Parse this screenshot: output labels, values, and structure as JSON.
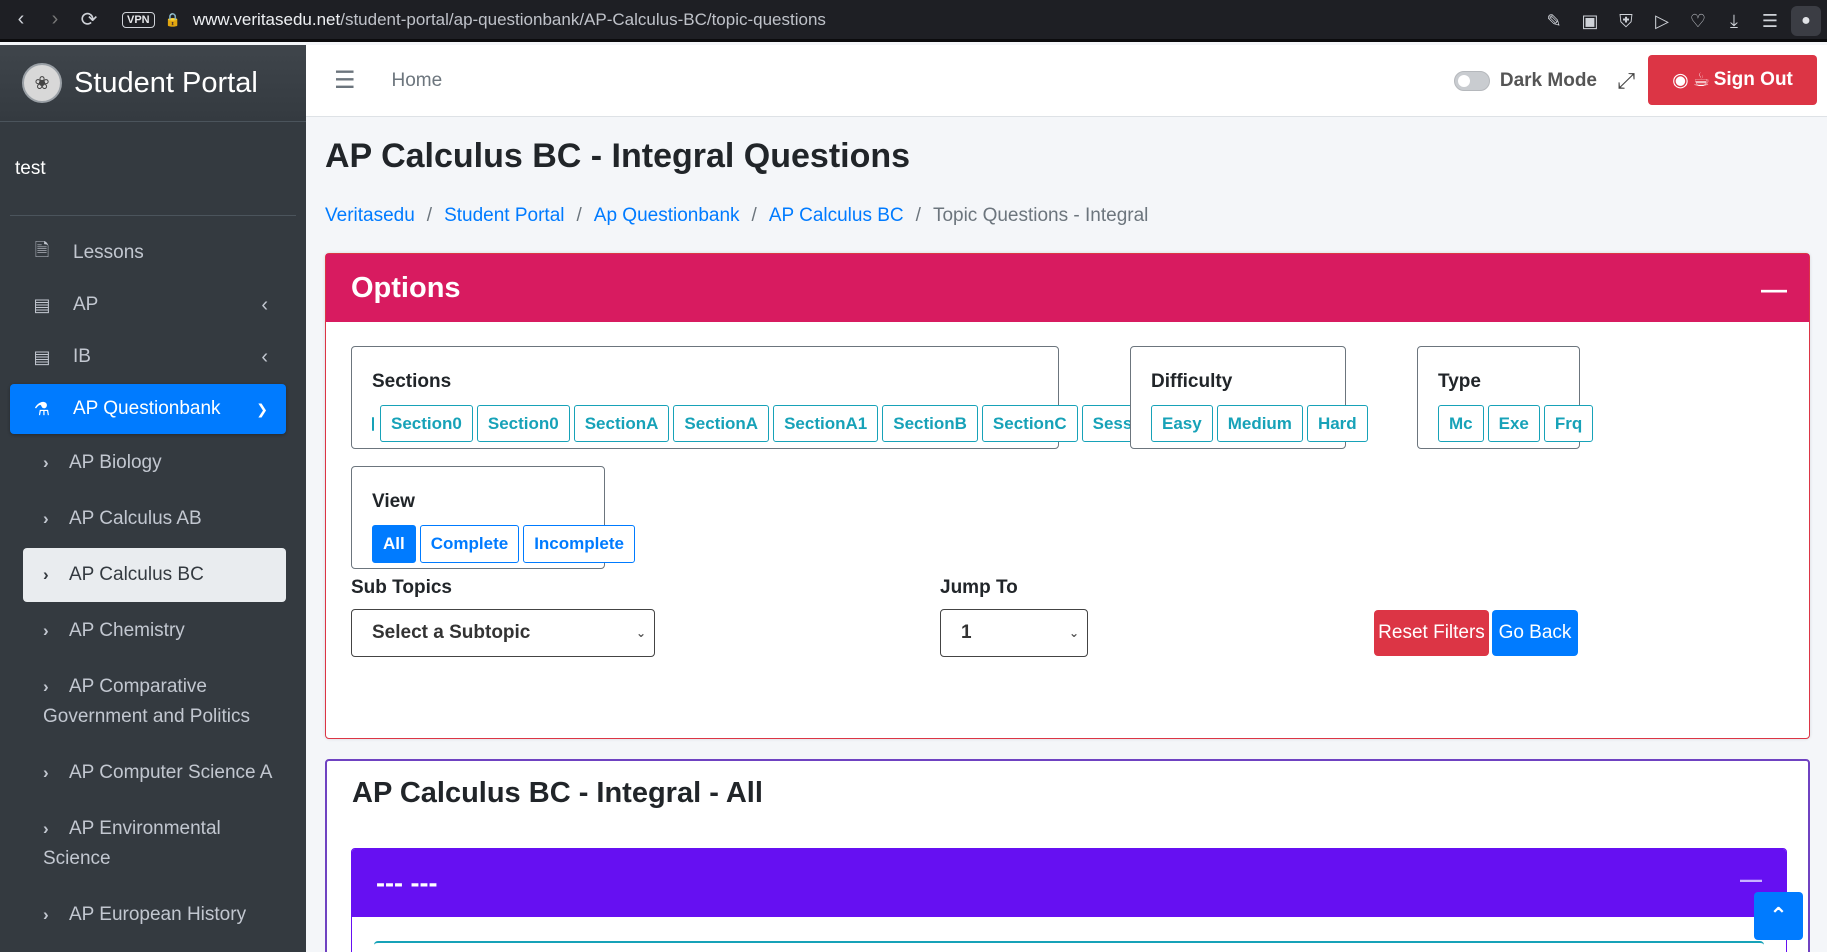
{
  "browser": {
    "url_domain": "www.veritasedu.net",
    "url_path": "/student-portal/ap-questionbank/AP-Calculus-BC/topic-questions",
    "vpn_label": "VPN"
  },
  "sidebar": {
    "brand": "Student Portal",
    "user": "test",
    "items": [
      {
        "label": "Lessons"
      },
      {
        "label": "AP"
      },
      {
        "label": "IB"
      },
      {
        "label": "AP Questionbank"
      }
    ],
    "sub_items": [
      {
        "label": "AP Biology"
      },
      {
        "label": "AP Calculus AB"
      },
      {
        "label": "AP Calculus BC"
      },
      {
        "label": "AP Chemistry"
      },
      {
        "label": "AP Comparative Government and Politics"
      },
      {
        "label": "AP Computer Science A"
      },
      {
        "label": "AP Environmental Science"
      },
      {
        "label": "AP European History"
      }
    ]
  },
  "topbar": {
    "home": "Home",
    "dark_mode": "Dark Mode",
    "sign_out": "Sign Out"
  },
  "page": {
    "title": "AP Calculus BC - Integral Questions",
    "breadcrumb": [
      "Veritasedu",
      "Student Portal",
      "Ap Questionbank",
      "AP Calculus BC",
      "Topic Questions - Integral"
    ]
  },
  "options": {
    "title": "Options",
    "sections": {
      "label": "Sections",
      "buttons": [
        "Section0",
        "Section0",
        "SectionA",
        "SectionA",
        "SectionA1",
        "SectionB",
        "SectionC",
        "SessionA"
      ]
    },
    "difficulty": {
      "label": "Difficulty",
      "buttons": [
        "Easy",
        "Medium",
        "Hard"
      ]
    },
    "type": {
      "label": "Type",
      "buttons": [
        "Mc",
        "Exe",
        "Frq"
      ]
    },
    "view": {
      "label": "View",
      "buttons": [
        "All",
        "Complete",
        "Incomplete"
      ],
      "selected": "All"
    },
    "subtopics": {
      "label": "Sub Topics",
      "value": "Select a Subtopic"
    },
    "jump_to": {
      "label": "Jump To",
      "value": "1"
    },
    "reset_label": "Reset Filters",
    "back_label": "Go Back"
  },
  "results": {
    "title": "AP Calculus BC - Integral - All",
    "inner_title": "--- ---"
  },
  "colors": {
    "options_header": "#d81b60",
    "inner_header": "#6610f2",
    "primary": "#007bff",
    "danger": "#dc3545",
    "info": "#17a2b8",
    "sidebar_bg": "#343a40"
  },
  "icons": {
    "back": "arrow-left-icon",
    "forward": "arrow-right-icon",
    "reload": "reload-icon",
    "menu": "hamburger-icon",
    "fullscreen": "expand-icon",
    "scroll_top": "chevron-up-icon"
  }
}
